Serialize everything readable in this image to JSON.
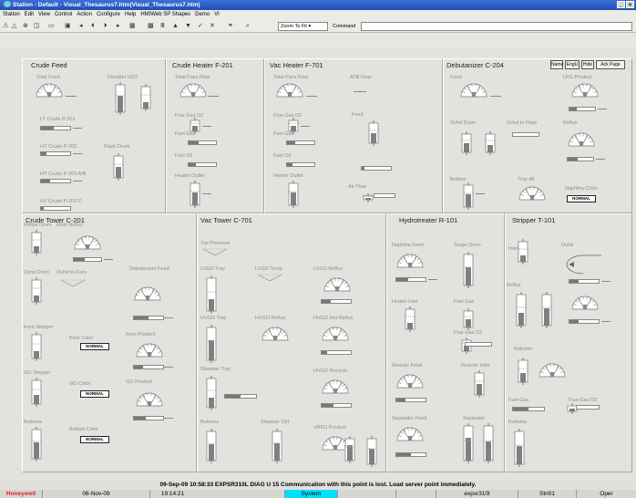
{
  "window": {
    "title": "Station - Default - Visual_Thesaurus7.htm(Visual_Thesaurus7.htm)"
  },
  "menu": [
    "Station",
    "Edit",
    "View",
    "Control",
    "Action",
    "Configure",
    "Help",
    "HMIWeb SP Shapes",
    "Demo",
    "VI"
  ],
  "toolbar": {
    "zoom": "Zoom To Fit",
    "command_label": "Command"
  },
  "top_buttons": [
    "Name",
    "EngU",
    "Hide",
    "Ack Page"
  ],
  "panels": {
    "crude_feed": {
      "title": "Crude Feed",
      "labels": [
        "Total Feed",
        "Desalter H2O",
        "LT Crude P-201",
        "HY Crude P-202",
        "Flash Drum",
        "HY Crude P-203 A/B",
        "HY Crude P-203 C"
      ]
    },
    "crude_heater": {
      "title": "Crude Heater F-201",
      "labels": [
        "Total Pass Flow",
        "Flue Gas O2",
        "Fuel Gas",
        "Fuel Oil",
        "Heater Outlet"
      ]
    },
    "vac_heater": {
      "title": "Vac Heater F-701",
      "labels": [
        "Total Pass Flow",
        "ATB Flow",
        "Flue Gas O2",
        "Feed",
        "Fuel Gas",
        "Fuel Oil",
        "Heater Outlet",
        "Air Flow"
      ]
    },
    "debutanizer": {
      "title": "Debutanizer C-204",
      "labels": [
        "Feed",
        "LPG Product",
        "Ovhd Drum",
        "Ovhd to Flare",
        "Reflux",
        "Bottom",
        "Tray 40",
        "Naphtha Color"
      ],
      "status": "NORMAL"
    },
    "crude_tower": {
      "title": "Crude Tower C-201",
      "labels": [
        "Reflux Drum",
        "Main Reflux",
        "Ovhd Drum",
        "Ovhd to Flare",
        "Debutanizer Feed",
        "Kero Stripper",
        "Kero Color",
        "Kero Product",
        "GO Stripper",
        "GO Color",
        "GO Product",
        "Bottoms",
        "Bottom Color"
      ],
      "status": "NORMAL"
    },
    "vac_tower": {
      "title": "Vac Tower C-701",
      "labels": [
        "Top Pressure",
        "LVGO Tray",
        "LVGO Temp",
        "LVGO Reflux",
        "HVGO Tray",
        "HVGO Reflux",
        "HVGO Hot Reflux",
        "Slopwax Tray",
        "HVGO Recycle",
        "Bottoms",
        "Slopwax Ctrl",
        "VRFO Product"
      ]
    },
    "hydrotreater": {
      "title": "Hydrotreater R-101",
      "labels": [
        "Naphtha Feed",
        "Surge Drum",
        "Heater Inlet",
        "Fuel Gas",
        "Flue Gas O2",
        "Reactor Feed",
        "Reactor Inlet",
        "Separator Feed",
        "Separator"
      ]
    },
    "stripper": {
      "title": "Stripper T-101",
      "labels": [
        "Inlet",
        "Ovhd",
        "Reflux",
        "Reboiler",
        "Fuel Gas",
        "Flue Gas O2",
        "Bottoms"
      ]
    }
  },
  "message": "09-Sep-09  10:58:33  EXPSR310L  DIAG  U 15 Communication with this point is lost.  Load server point immediately.",
  "statusbar": {
    "brand": "Honeywell",
    "date": "06-Nov-09",
    "time": "19:14:21",
    "mode": "System",
    "server": "expsr310l",
    "station": "Stn01",
    "access": "Oper"
  },
  "colors": {
    "title_bar": "#1f4fb4",
    "system_status": "#00e0ff",
    "brand": "#e02020",
    "panel_bg": "#e4e2de",
    "gauge": "#888888"
  }
}
